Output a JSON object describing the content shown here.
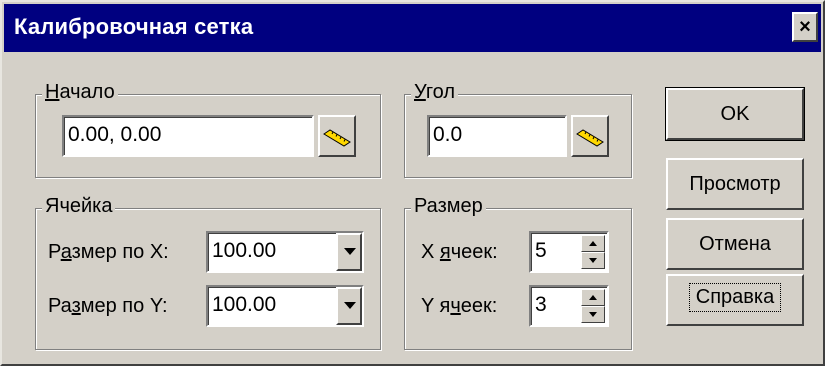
{
  "window": {
    "title": "Калибровочная сетка",
    "close_label": "×"
  },
  "origin_group": {
    "legend_u": "Н",
    "legend_rest": "ачало",
    "value": "0.00, 0.00"
  },
  "angle_group": {
    "legend_u": "У",
    "legend_rest": "гол",
    "value": "0.0"
  },
  "cell_group": {
    "legend": "Ячейка",
    "size_x": {
      "label_pre": "Р",
      "label_u": "а",
      "label_post": "змер по X:",
      "value": "100.00"
    },
    "size_y": {
      "label_pre": "Ра",
      "label_u": "з",
      "label_post": "мер по Y:",
      "value": "100.00"
    }
  },
  "size_group": {
    "legend": "Размер",
    "x_cells": {
      "label_pre": "X ",
      "label_u": "я",
      "label_post": "чеек:",
      "value": "5"
    },
    "y_cells": {
      "label_pre": "Y я",
      "label_u": "ч",
      "label_post": "еек:",
      "value": "3"
    }
  },
  "buttons": {
    "ok": "OK",
    "preview": "Просмотр",
    "cancel": "Отмена",
    "help": "Справка"
  },
  "icons": {
    "measure": "ruler-icon"
  }
}
